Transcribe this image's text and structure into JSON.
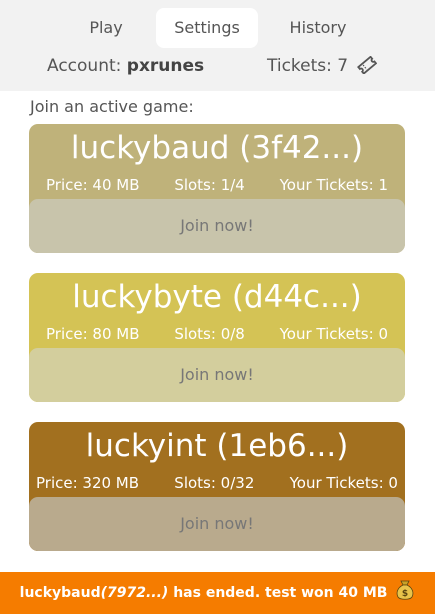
{
  "nav": {
    "tabs": [
      {
        "label": "Play"
      },
      {
        "label": "Settings",
        "active": true
      },
      {
        "label": "History"
      }
    ]
  },
  "account": {
    "label": "Account:",
    "name": "pxrunes"
  },
  "tickets": {
    "label": "Tickets:",
    "count": "7",
    "icon": "ticket-icon"
  },
  "join_label": "Join an active game:",
  "games": [
    {
      "title": "luckybaud (3f42...)",
      "price": "Price: 40 MB",
      "slots": "Slots: 1/4",
      "your_tickets": "Your Tickets: 1",
      "button": "Join now!",
      "color": "#bfb27a"
    },
    {
      "title": "luckybyte (d44c...)",
      "price": "Price: 80 MB",
      "slots": "Slots: 0/8",
      "your_tickets": "Your Tickets: 0",
      "button": "Join now!",
      "color": "#d4c355"
    },
    {
      "title": "luckyint (1eb6...)",
      "price": "Price: 320 MB",
      "slots": "Slots: 0/32",
      "your_tickets": "Your Tickets: 0",
      "button": "Join now!",
      "color": "#a2701f"
    }
  ],
  "notification": {
    "game": "luckybaud",
    "game_id": "(7972...)",
    "message": " has ended. test won 40 MB",
    "icon": "money-bag-icon",
    "color": "#f57c00"
  }
}
